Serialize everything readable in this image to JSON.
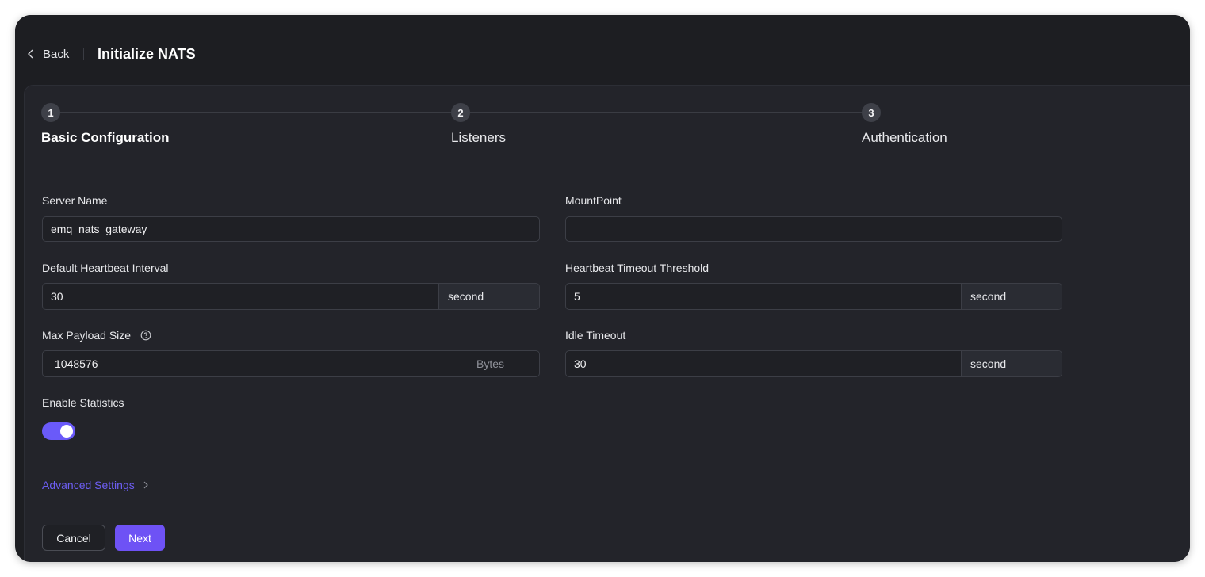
{
  "header": {
    "back_label": "Back",
    "title": "Initialize NATS"
  },
  "steps": [
    {
      "number": "1",
      "label": "Basic Configuration",
      "active": true
    },
    {
      "number": "2",
      "label": "Listeners",
      "active": false
    },
    {
      "number": "3",
      "label": "Authentication",
      "active": false
    }
  ],
  "form": {
    "server_name": {
      "label": "Server Name",
      "value": "emq_nats_gateway"
    },
    "mountpoint": {
      "label": "MountPoint",
      "value": ""
    },
    "heartbeat_interval": {
      "label": "Default Heartbeat Interval",
      "value": "30",
      "unit": "second"
    },
    "heartbeat_timeout": {
      "label": "Heartbeat Timeout Threshold",
      "value": "5",
      "unit": "second"
    },
    "max_payload": {
      "label": "Max Payload Size",
      "value": "1048576",
      "suffix": "Bytes",
      "help_icon": "question-circle-icon"
    },
    "idle_timeout": {
      "label": "Idle Timeout",
      "value": "30",
      "unit": "second"
    },
    "enable_statistics": {
      "label": "Enable Statistics",
      "enabled": true
    }
  },
  "advanced_settings_label": "Advanced Settings",
  "buttons": {
    "cancel": "Cancel",
    "next": "Next"
  },
  "colors": {
    "accent": "#6e52f5",
    "link": "#6d5ef3",
    "background": "#1d1e22",
    "panel": "#23242a"
  }
}
